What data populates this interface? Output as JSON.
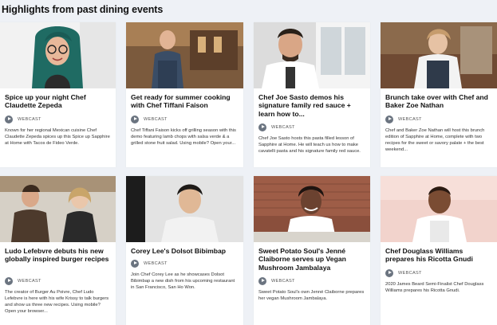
{
  "section": {
    "title": "Highlights from past dining events"
  },
  "badge_label": "WEBCAST",
  "cards": [
    {
      "title": "Spice up your night Chef Claudette Zepeda",
      "badge": "WEBCAST",
      "description": "Known for her regional Mexican cuisine Chef Claudette Zepeda spices up this Spice up Sapphire at Home with Tacos de Fideo Verde.",
      "photo": "chef-claudette-zepeda-photo"
    },
    {
      "title": "Get ready for summer cooking with Chef Tiffani Faison",
      "badge": "WEBCAST",
      "description": "Chef Tiffani Faison kicks off grilling season with this demo featuring lamb chops with salsa verde & a grilled stone fruit salad. Using mobile? Open your...",
      "photo": "chef-tiffani-faison-photo"
    },
    {
      "title": "Chef Joe Sasto demos his signature family red sauce + learn how to...",
      "badge": "WEBCAST",
      "description": "Chef Joe Sasto hosts this pasta filled lesson of Sapphire at Home. He will teach us how to make cavatelli pasta and his signature family red sauce.",
      "photo": "chef-joe-sasto-photo"
    },
    {
      "title": "Brunch take over with Chef and Baker Zoe Nathan",
      "badge": "WEBCAST",
      "description": "Chef and Baker Zoe Nathan will host this brunch edition of Sapphire at Home, complete with two recipes for the sweet or savory palate + the best weekend...",
      "photo": "chef-zoe-nathan-photo"
    },
    {
      "title": "Ludo Lefebvre debuts his new globally inspired burger recipes",
      "badge": "WEBCAST",
      "description": "The creator of Burger Au Poivre, Chef Ludo Lefebvre is here with his wife Krissy to talk burgers and show us three new recipes. Using mobile? Open your browser...",
      "photo": "chef-ludo-lefebvre-photo"
    },
    {
      "title": "Corey Lee's Dolsot Bibimbap",
      "badge": "WEBCAST",
      "description": "Join Chef Corey Lee as he showcases Dolsot Bibimbap a new dish from his upcoming restaurant in San Francisco, San Ho Won.",
      "photo": "chef-corey-lee-photo"
    },
    {
      "title": "Sweet Potato Soul's Jenné Claiborne serves up Vegan Mushroom Jambalaya",
      "badge": "WEBCAST",
      "description": "Sweet Potato Soul's own Jenné Claiborne prepares her vegan Mushroom Jambalaya.",
      "photo": "chef-jenne-claiborne-photo"
    },
    {
      "title": "Chef Douglass Williams prepares his Ricotta Gnudi",
      "badge": "WEBCAST",
      "description": "2020 James Beard Semi-Finalist Chef Douglass Williams prepares his Ricotta Gnudi.",
      "photo": "chef-douglass-williams-photo"
    }
  ],
  "colors": {
    "background": "#eef1f6",
    "card": "#ffffff",
    "badge_icon": "#6b7480"
  }
}
